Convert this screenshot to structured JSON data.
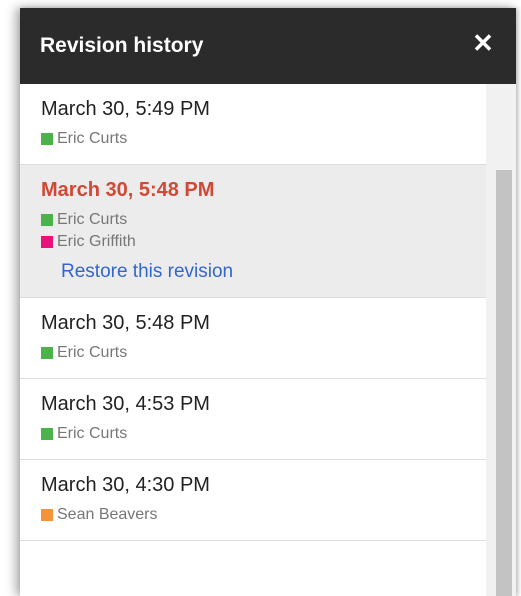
{
  "header": {
    "title": "Revision history",
    "close_glyph": "✕"
  },
  "revisions": [
    {
      "date": "March 30, 5:49 PM",
      "selected": false,
      "authors": [
        {
          "name": "Eric Curts",
          "color": "#4cb24c"
        }
      ]
    },
    {
      "date": "March 30, 5:48 PM",
      "selected": true,
      "authors": [
        {
          "name": "Eric Curts",
          "color": "#4cb24c"
        },
        {
          "name": "Eric Griffith",
          "color": "#e8127a"
        }
      ],
      "restore_label": "Restore this revision"
    },
    {
      "date": "March 30, 5:48 PM",
      "selected": false,
      "authors": [
        {
          "name": "Eric Curts",
          "color": "#4cb24c"
        }
      ]
    },
    {
      "date": "March 30, 4:53 PM",
      "selected": false,
      "authors": [
        {
          "name": "Eric Curts",
          "color": "#4cb24c"
        }
      ]
    },
    {
      "date": "March 30, 4:30 PM",
      "selected": false,
      "authors": [
        {
          "name": "Sean Beavers",
          "color": "#f4943a"
        }
      ]
    }
  ],
  "icons": {
    "close": "close-icon"
  }
}
